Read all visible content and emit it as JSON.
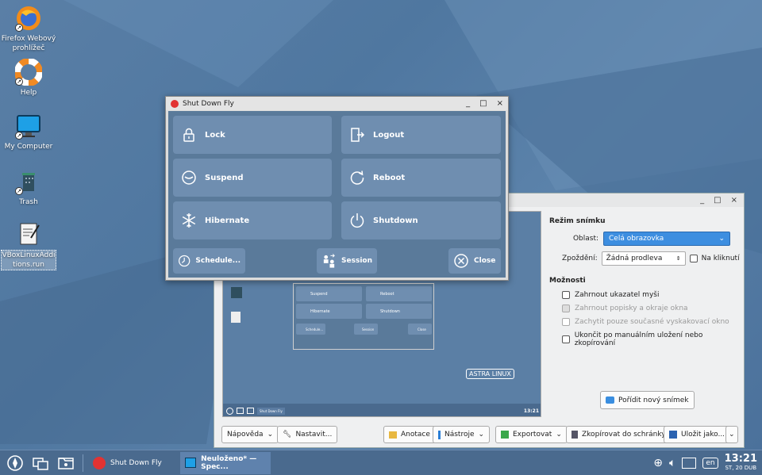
{
  "desktop": {
    "icons": [
      {
        "label": "Firefox Webový prohlížeč",
        "icon": "firefox-icon"
      },
      {
        "label": "Help",
        "icon": "lifebuoy-icon"
      },
      {
        "label": "My Computer",
        "icon": "monitor-icon"
      },
      {
        "label": "Trash",
        "icon": "trash-icon"
      },
      {
        "label": "VBoxLinuxAdditions.run",
        "icon": "script-file-icon"
      }
    ]
  },
  "shutdown_window": {
    "title": "Shut Down Fly",
    "buttons": {
      "lock": "Lock",
      "logout": "Logout",
      "suspend": "Suspend",
      "reboot": "Reboot",
      "hibernate": "Hibernate",
      "shutdown": "Shutdown",
      "schedule": "Schedule...",
      "session": "Session",
      "close": "Close"
    }
  },
  "spectacle": {
    "capture_mode": {
      "header": "Režim snímku",
      "area_label": "Oblast:",
      "area_value": "Celá obrazovka",
      "delay_label": "Zpoždění:",
      "delay_value": "Žádná prodleva",
      "on_click_label": "Na kliknutí"
    },
    "options": {
      "header": "Možnosti",
      "include_pointer": "Zahrnout ukazatel myši",
      "include_decorations": "Zahrnout popisky a okraje okna",
      "popups_only": "Zachytit pouze současné vyskakovací okno",
      "quit_after_save": "Ukončit po manuálním uložení nebo zkopírování"
    },
    "new_screenshot": "Pořídit nový snímek",
    "bottom": {
      "help": "Nápověda",
      "configure": "Nastavit...",
      "annotate": "Anotace",
      "tools": "Nástroje",
      "export": "Exportovat",
      "copy": "Zkopírovat do schránky",
      "save_as": "Uložit jako..."
    },
    "preview": {
      "brand": "ASTRA LINUX",
      "mini_buttons": [
        "Suspend",
        "Reboot",
        "Hibernate",
        "Shutdown",
        "Schedule...",
        "Session",
        "Close"
      ],
      "mini_task": "Shut Down Fly",
      "mini_clock": "13:21"
    }
  },
  "taskbar": {
    "tasks": [
      {
        "label": "Shut Down Fly"
      },
      {
        "label": "Neuloženo* — Spec..."
      }
    ],
    "lang": "en",
    "time": "13:21",
    "date": "ST, 20 DUB"
  },
  "colors": {
    "accent": "#3d8ee0",
    "shutdown_red": "#e23333"
  }
}
